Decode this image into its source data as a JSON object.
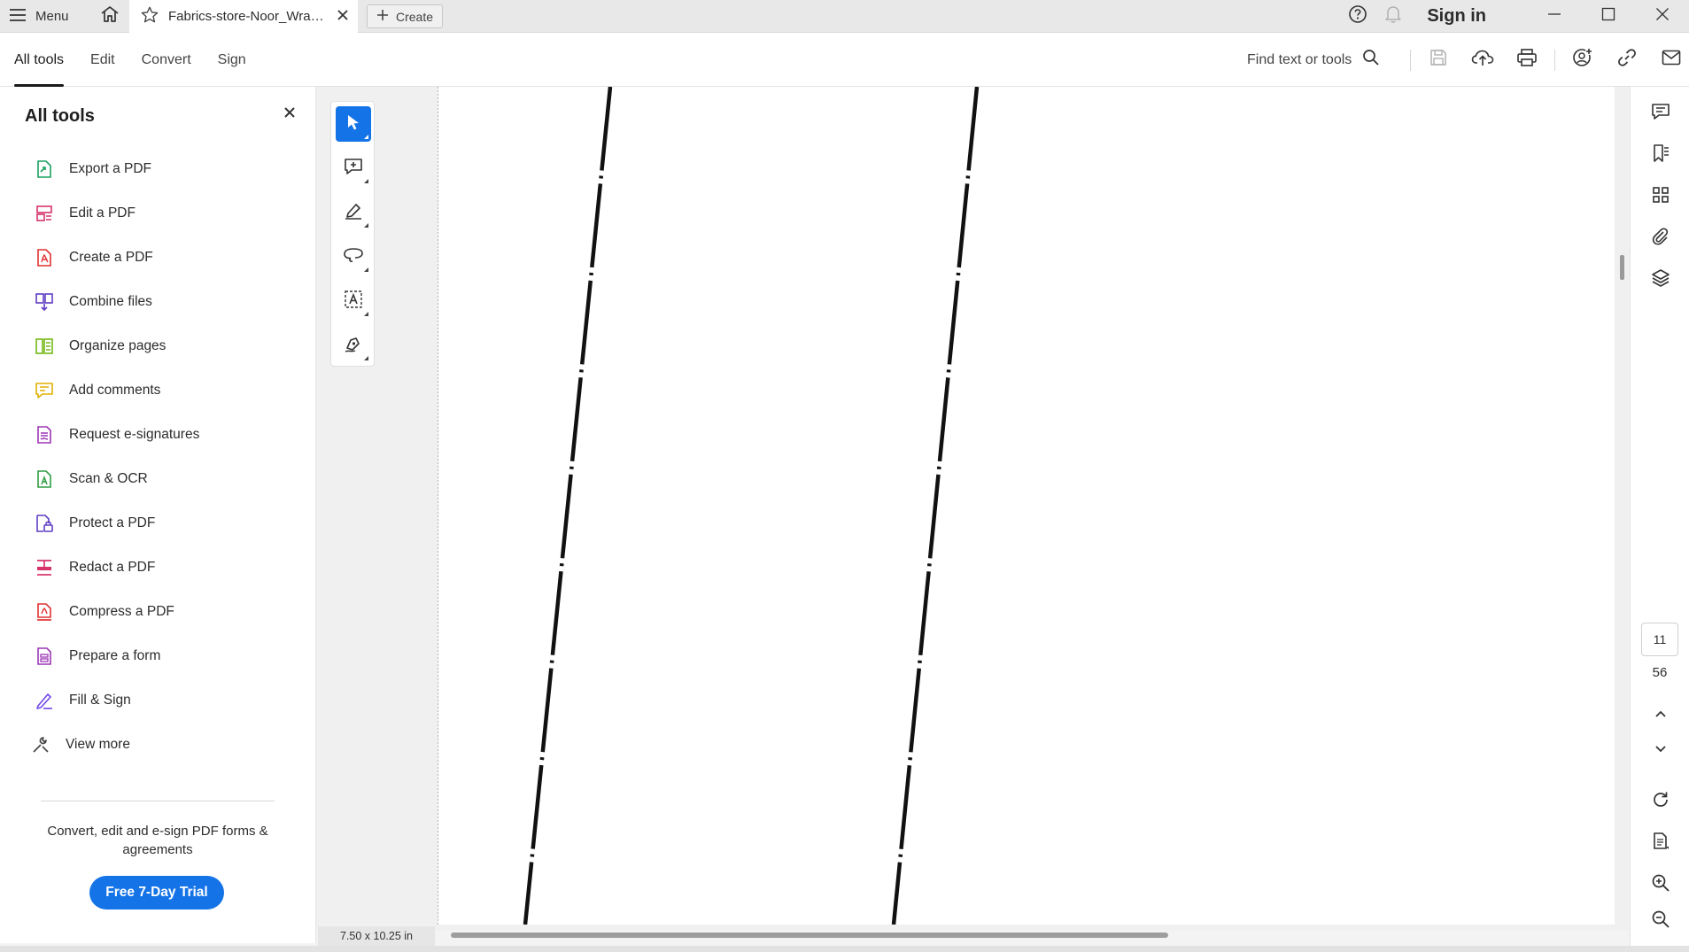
{
  "titlebar": {
    "menu_label": "Menu",
    "tab_title": "Fabrics-store-Noor_Wrap...",
    "create_label": "Create",
    "sign_in_label": "Sign in"
  },
  "toolbar": {
    "tabs": [
      {
        "label": "All tools",
        "active": true
      },
      {
        "label": "Edit",
        "active": false
      },
      {
        "label": "Convert",
        "active": false
      },
      {
        "label": "Sign",
        "active": false
      }
    ],
    "find_label": "Find text or tools"
  },
  "left_panel": {
    "title": "All tools",
    "tools": [
      {
        "label": "Export a PDF",
        "icon": "export-pdf-icon",
        "color": "#1aa260"
      },
      {
        "label": "Edit a PDF",
        "icon": "edit-pdf-icon",
        "color": "#d6336c"
      },
      {
        "label": "Create a PDF",
        "icon": "create-pdf-icon",
        "color": "#e03131"
      },
      {
        "label": "Combine files",
        "icon": "combine-files-icon",
        "color": "#5f3dc4"
      },
      {
        "label": "Organize pages",
        "icon": "organize-pages-icon",
        "color": "#74b816"
      },
      {
        "label": "Add comments",
        "icon": "add-comments-icon",
        "color": "#e0b000"
      },
      {
        "label": "Request e-signatures",
        "icon": "request-esignatures-icon",
        "color": "#9c36b5"
      },
      {
        "label": "Scan & OCR",
        "icon": "scan-ocr-icon",
        "color": "#2f9e44"
      },
      {
        "label": "Protect a PDF",
        "icon": "protect-pdf-icon",
        "color": "#5f3dc4"
      },
      {
        "label": "Redact a PDF",
        "icon": "redact-pdf-icon",
        "color": "#d6336c"
      },
      {
        "label": "Compress a PDF",
        "icon": "compress-pdf-icon",
        "color": "#e03131"
      },
      {
        "label": "Prepare a form",
        "icon": "prepare-form-icon",
        "color": "#9c36b5"
      },
      {
        "label": "Fill & Sign",
        "icon": "fill-sign-icon",
        "color": "#7048e8"
      },
      {
        "label": "View more",
        "icon": "wrench-icon",
        "color": "#444444"
      }
    ],
    "promo_text": "Convert, edit and e-sign PDF forms & agreements",
    "trial_button": "Free 7-Day Trial"
  },
  "document": {
    "page_size": "7.50 x 10.25 in"
  },
  "navigation": {
    "current_page": "11",
    "total_pages": "56"
  },
  "colors": {
    "accent": "#1473e6"
  }
}
